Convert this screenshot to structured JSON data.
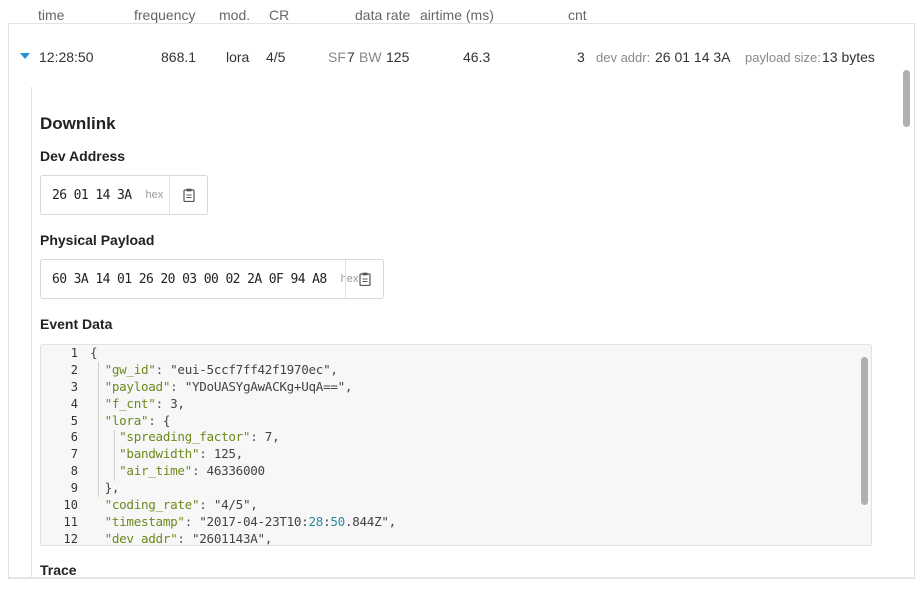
{
  "columns": {
    "time": "time",
    "frequency": "frequency",
    "mod": "mod.",
    "cr": "CR",
    "data_rate": "data rate",
    "airtime": "airtime (ms)",
    "cnt": "cnt"
  },
  "message": {
    "time": "12:28:50",
    "frequency": "868.1",
    "mod": "lora",
    "cr": "4/5",
    "sf_label": "SF",
    "sf_value": "7",
    "bw_label": "BW",
    "bw_value": "125",
    "airtime": "46.3",
    "cnt": "3",
    "dev_addr_label": "dev addr:",
    "dev_addr_value": "26 01 14 3A",
    "payload_size_label": "payload size:",
    "payload_size_value": "13 bytes"
  },
  "detail": {
    "heading": "Downlink",
    "dev_address": {
      "label": "Dev Address",
      "value": "26 01 14 3A",
      "format": "hex"
    },
    "physical_payload": {
      "label": "Physical Payload",
      "value": "60 3A 14 01 26 20 03 00 02 2A 0F 94 A8",
      "format": "hex"
    },
    "event_data": {
      "label": "Event Data",
      "line_numbers": [
        "1",
        "2",
        "3",
        "4",
        "5",
        "6",
        "7",
        "8",
        "9",
        "10",
        "11",
        "12"
      ],
      "lines": [
        "{",
        "  \"gw_id\": \"eui-5ccf7ff42f1970ec\",",
        "  \"payload\": \"YDoUASYgAwACKg+UqA==\",",
        "  \"f_cnt\": 3,",
        "  \"lora\": {",
        "    \"spreading_factor\": 7,",
        "    \"bandwidth\": 125,",
        "    \"air_time\": 46336000",
        "  },",
        "  \"coding_rate\": \"4/5\",",
        "  \"timestamp\": \"2017-04-23T10:28:50.844Z\",",
        "  \"dev_addr\": \"2601143A\","
      ]
    },
    "trace_label": "Trace"
  },
  "colors": {
    "accent": "#2a8ed9",
    "json_key": "#6c8a1e",
    "json_number": "#2a8a9e"
  },
  "icons": {
    "expand": "caret-down-icon",
    "copy": "clipboard-icon"
  }
}
